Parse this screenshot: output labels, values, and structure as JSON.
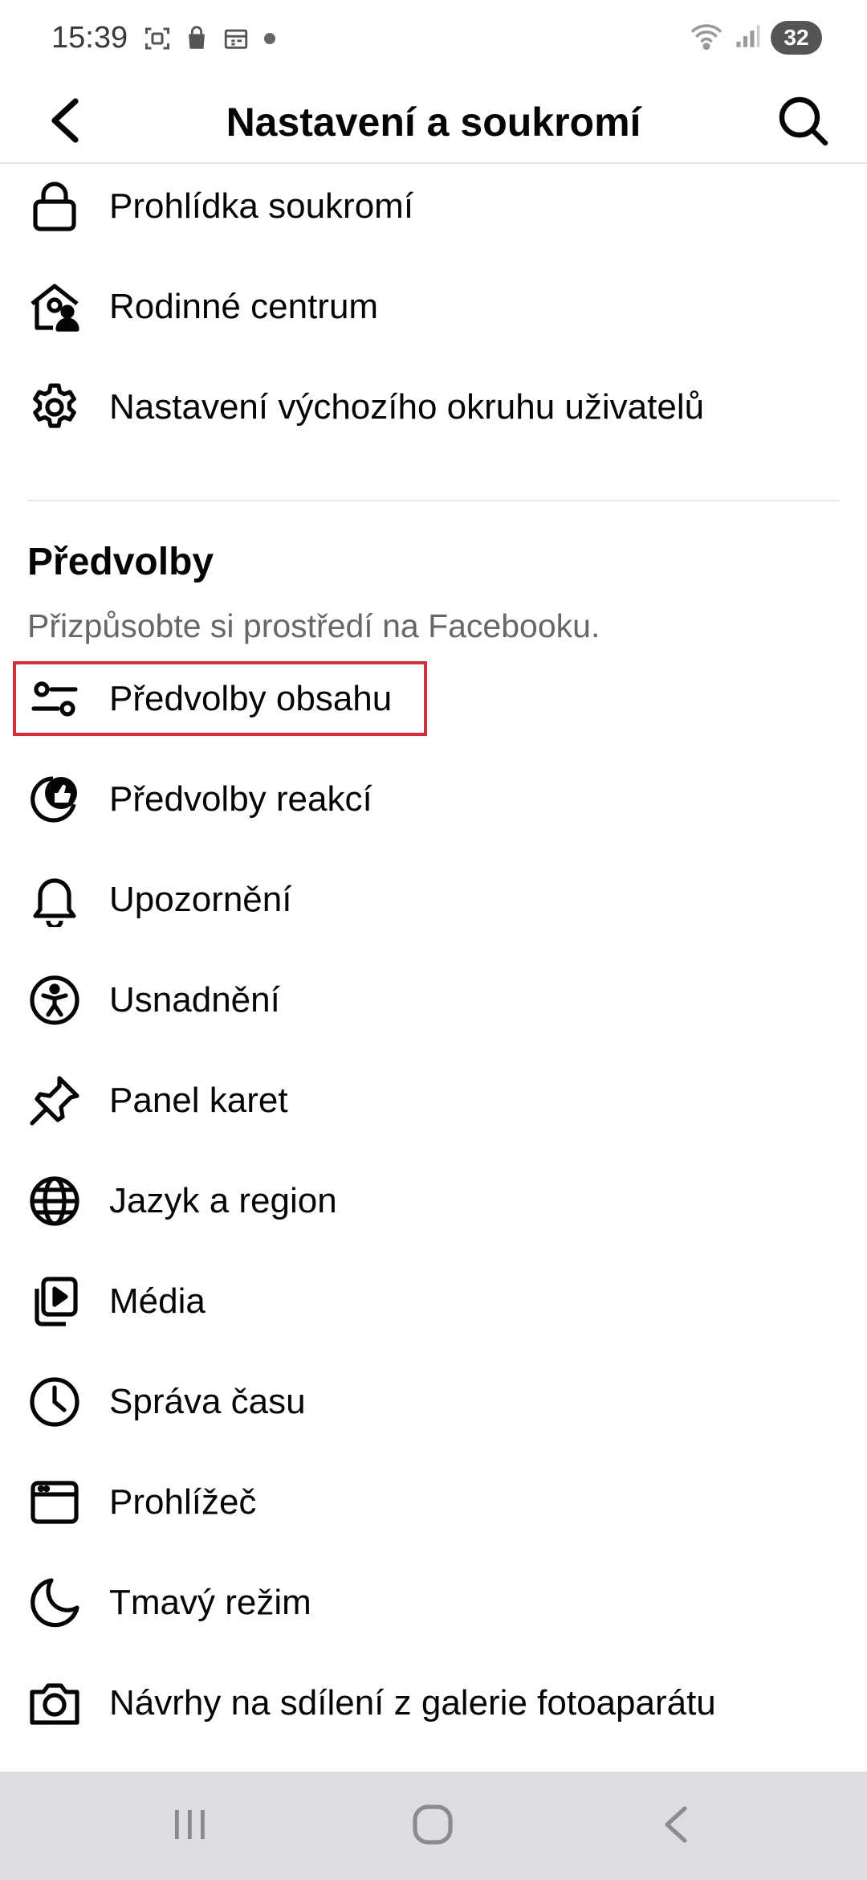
{
  "status": {
    "time": "15:39",
    "battery": "32"
  },
  "header": {
    "title": "Nastavení a soukromí"
  },
  "top_items": [
    {
      "label": "Prohlídka soukromí",
      "icon": "lock-icon"
    },
    {
      "label": "Rodinné centrum",
      "icon": "family-center-icon"
    },
    {
      "label": "Nastavení výchozího okruhu uživatelů",
      "icon": "gear-icon"
    }
  ],
  "preferences": {
    "title": "Předvolby",
    "subtitle": "Přizpůsobte si prostředí na Facebooku.",
    "items": [
      {
        "label": "Předvolby obsahu",
        "icon": "sliders-icon"
      },
      {
        "label": "Předvolby reakcí",
        "icon": "reaction-like-icon"
      },
      {
        "label": "Upozornění",
        "icon": "bell-icon"
      },
      {
        "label": "Usnadnění",
        "icon": "accessibility-icon"
      },
      {
        "label": "Panel karet",
        "icon": "pin-icon"
      },
      {
        "label": "Jazyk a region",
        "icon": "globe-icon"
      },
      {
        "label": "Média",
        "icon": "media-play-icon"
      },
      {
        "label": "Správa času",
        "icon": "clock-icon"
      },
      {
        "label": "Prohlížeč",
        "icon": "browser-icon"
      },
      {
        "label": "Tmavý režim",
        "icon": "moon-icon"
      },
      {
        "label": "Návrhy na sdílení z galerie fotoaparátu",
        "icon": "camera-icon"
      }
    ]
  },
  "colors": {
    "highlight": "#d32f3a",
    "secondary_text": "#65676b",
    "nav_bar": "#dcdde0"
  }
}
